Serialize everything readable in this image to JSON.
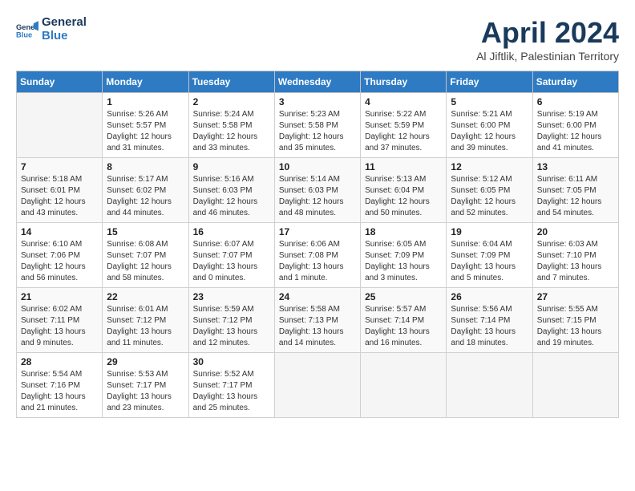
{
  "header": {
    "logo_line1": "General",
    "logo_line2": "Blue",
    "month": "April 2024",
    "location": "Al Jiftlik, Palestinian Territory"
  },
  "weekdays": [
    "Sunday",
    "Monday",
    "Tuesday",
    "Wednesday",
    "Thursday",
    "Friday",
    "Saturday"
  ],
  "weeks": [
    [
      {
        "day": "",
        "info": ""
      },
      {
        "day": "1",
        "info": "Sunrise: 5:26 AM\nSunset: 5:57 PM\nDaylight: 12 hours\nand 31 minutes."
      },
      {
        "day": "2",
        "info": "Sunrise: 5:24 AM\nSunset: 5:58 PM\nDaylight: 12 hours\nand 33 minutes."
      },
      {
        "day": "3",
        "info": "Sunrise: 5:23 AM\nSunset: 5:58 PM\nDaylight: 12 hours\nand 35 minutes."
      },
      {
        "day": "4",
        "info": "Sunrise: 5:22 AM\nSunset: 5:59 PM\nDaylight: 12 hours\nand 37 minutes."
      },
      {
        "day": "5",
        "info": "Sunrise: 5:21 AM\nSunset: 6:00 PM\nDaylight: 12 hours\nand 39 minutes."
      },
      {
        "day": "6",
        "info": "Sunrise: 5:19 AM\nSunset: 6:00 PM\nDaylight: 12 hours\nand 41 minutes."
      }
    ],
    [
      {
        "day": "7",
        "info": "Sunrise: 5:18 AM\nSunset: 6:01 PM\nDaylight: 12 hours\nand 43 minutes."
      },
      {
        "day": "8",
        "info": "Sunrise: 5:17 AM\nSunset: 6:02 PM\nDaylight: 12 hours\nand 44 minutes."
      },
      {
        "day": "9",
        "info": "Sunrise: 5:16 AM\nSunset: 6:03 PM\nDaylight: 12 hours\nand 46 minutes."
      },
      {
        "day": "10",
        "info": "Sunrise: 5:14 AM\nSunset: 6:03 PM\nDaylight: 12 hours\nand 48 minutes."
      },
      {
        "day": "11",
        "info": "Sunrise: 5:13 AM\nSunset: 6:04 PM\nDaylight: 12 hours\nand 50 minutes."
      },
      {
        "day": "12",
        "info": "Sunrise: 5:12 AM\nSunset: 6:05 PM\nDaylight: 12 hours\nand 52 minutes."
      },
      {
        "day": "13",
        "info": "Sunrise: 6:11 AM\nSunset: 7:05 PM\nDaylight: 12 hours\nand 54 minutes."
      }
    ],
    [
      {
        "day": "14",
        "info": "Sunrise: 6:10 AM\nSunset: 7:06 PM\nDaylight: 12 hours\nand 56 minutes."
      },
      {
        "day": "15",
        "info": "Sunrise: 6:08 AM\nSunset: 7:07 PM\nDaylight: 12 hours\nand 58 minutes."
      },
      {
        "day": "16",
        "info": "Sunrise: 6:07 AM\nSunset: 7:07 PM\nDaylight: 13 hours\nand 0 minutes."
      },
      {
        "day": "17",
        "info": "Sunrise: 6:06 AM\nSunset: 7:08 PM\nDaylight: 13 hours\nand 1 minute."
      },
      {
        "day": "18",
        "info": "Sunrise: 6:05 AM\nSunset: 7:09 PM\nDaylight: 13 hours\nand 3 minutes."
      },
      {
        "day": "19",
        "info": "Sunrise: 6:04 AM\nSunset: 7:09 PM\nDaylight: 13 hours\nand 5 minutes."
      },
      {
        "day": "20",
        "info": "Sunrise: 6:03 AM\nSunset: 7:10 PM\nDaylight: 13 hours\nand 7 minutes."
      }
    ],
    [
      {
        "day": "21",
        "info": "Sunrise: 6:02 AM\nSunset: 7:11 PM\nDaylight: 13 hours\nand 9 minutes."
      },
      {
        "day": "22",
        "info": "Sunrise: 6:01 AM\nSunset: 7:12 PM\nDaylight: 13 hours\nand 11 minutes."
      },
      {
        "day": "23",
        "info": "Sunrise: 5:59 AM\nSunset: 7:12 PM\nDaylight: 13 hours\nand 12 minutes."
      },
      {
        "day": "24",
        "info": "Sunrise: 5:58 AM\nSunset: 7:13 PM\nDaylight: 13 hours\nand 14 minutes."
      },
      {
        "day": "25",
        "info": "Sunrise: 5:57 AM\nSunset: 7:14 PM\nDaylight: 13 hours\nand 16 minutes."
      },
      {
        "day": "26",
        "info": "Sunrise: 5:56 AM\nSunset: 7:14 PM\nDaylight: 13 hours\nand 18 minutes."
      },
      {
        "day": "27",
        "info": "Sunrise: 5:55 AM\nSunset: 7:15 PM\nDaylight: 13 hours\nand 19 minutes."
      }
    ],
    [
      {
        "day": "28",
        "info": "Sunrise: 5:54 AM\nSunset: 7:16 PM\nDaylight: 13 hours\nand 21 minutes."
      },
      {
        "day": "29",
        "info": "Sunrise: 5:53 AM\nSunset: 7:17 PM\nDaylight: 13 hours\nand 23 minutes."
      },
      {
        "day": "30",
        "info": "Sunrise: 5:52 AM\nSunset: 7:17 PM\nDaylight: 13 hours\nand 25 minutes."
      },
      {
        "day": "",
        "info": ""
      },
      {
        "day": "",
        "info": ""
      },
      {
        "day": "",
        "info": ""
      },
      {
        "day": "",
        "info": ""
      }
    ]
  ]
}
